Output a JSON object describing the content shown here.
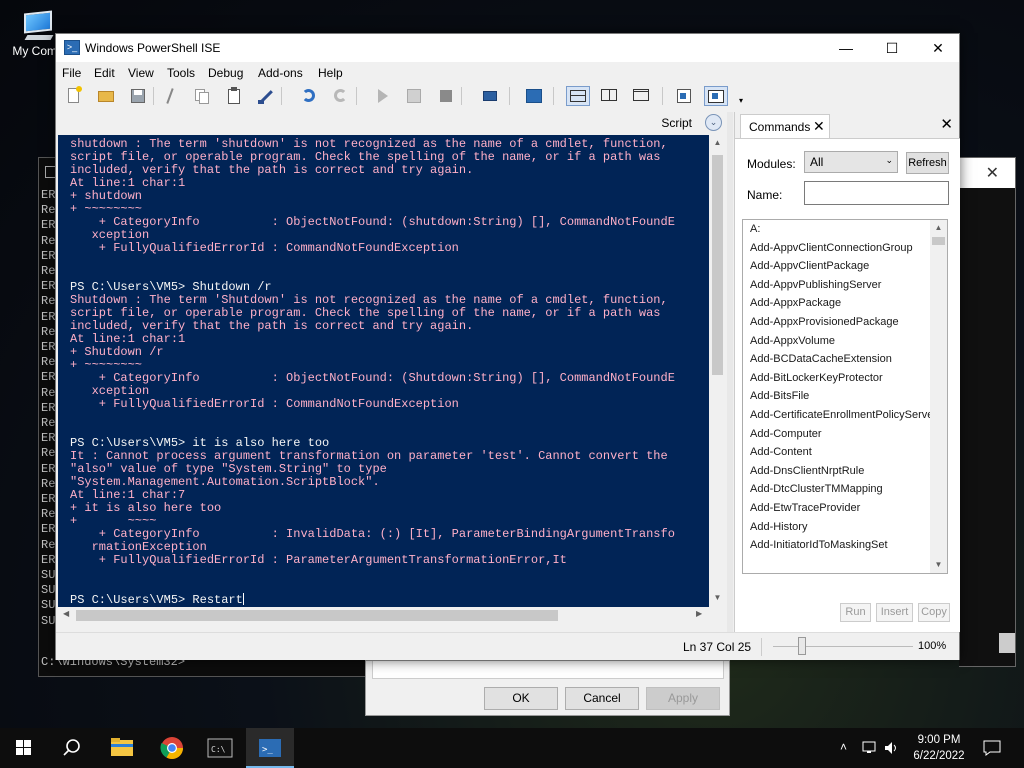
{
  "desktop": {
    "icon_label": "My Comp"
  },
  "bg_cmd": {
    "line_prefixes": [
      "ER",
      "Re",
      "ER",
      "Re",
      "ER",
      "Re",
      "ER",
      "Re",
      "ER",
      "Re",
      "ER",
      "Re",
      "ER",
      "Re",
      "ER",
      "Re",
      "ER",
      "Re",
      "ER",
      "Re",
      "ER",
      "Re",
      "ER",
      "Re",
      "ER",
      "SU",
      "SU",
      "SU",
      "SU"
    ],
    "prompt": "C:\\Windows\\System32>"
  },
  "dialog": {
    "ok": "OK",
    "cancel": "Cancel",
    "apply": "Apply"
  },
  "ise": {
    "title": "Windows PowerShell ISE",
    "menu": [
      "File",
      "Edit",
      "View",
      "Tools",
      "Debug",
      "Add-ons",
      "Help"
    ],
    "script_label": "Script",
    "console_lines": [
      {
        "t": "shutdown : The term 'shutdown' is not recognized as the name of a cmdlet, function,",
        "c": "e"
      },
      {
        "t": "script file, or operable program. Check the spelling of the name, or if a path was",
        "c": "e"
      },
      {
        "t": "included, verify that the path is correct and try again.",
        "c": "e"
      },
      {
        "t": "At line:1 char:1",
        "c": "e"
      },
      {
        "t": "+ shutdown",
        "c": "e"
      },
      {
        "t": "+ ~~~~~~~~",
        "c": "e"
      },
      {
        "t": "    + CategoryInfo          : ObjectNotFound: (shutdown:String) [], CommandNotFoundE",
        "c": "e"
      },
      {
        "t": "   xception",
        "c": "e"
      },
      {
        "t": "    + FullyQualifiedErrorId : CommandNotFoundException",
        "c": "e"
      },
      {
        "t": "",
        "c": "w"
      },
      {
        "t": "",
        "c": "w"
      },
      {
        "t": "PS C:\\Users\\VM5> Shutdown /r",
        "c": "w"
      },
      {
        "t": "Shutdown : The term 'Shutdown' is not recognized as the name of a cmdlet, function,",
        "c": "e"
      },
      {
        "t": "script file, or operable program. Check the spelling of the name, or if a path was",
        "c": "e"
      },
      {
        "t": "included, verify that the path is correct and try again.",
        "c": "e"
      },
      {
        "t": "At line:1 char:1",
        "c": "e"
      },
      {
        "t": "+ Shutdown /r",
        "c": "e"
      },
      {
        "t": "+ ~~~~~~~~",
        "c": "e"
      },
      {
        "t": "    + CategoryInfo          : ObjectNotFound: (Shutdown:String) [], CommandNotFoundE",
        "c": "e"
      },
      {
        "t": "   xception",
        "c": "e"
      },
      {
        "t": "    + FullyQualifiedErrorId : CommandNotFoundException",
        "c": "e"
      },
      {
        "t": "",
        "c": "w"
      },
      {
        "t": "",
        "c": "w"
      },
      {
        "t": "PS C:\\Users\\VM5> it is also here too",
        "c": "w"
      },
      {
        "t": "It : Cannot process argument transformation on parameter 'test'. Cannot convert the",
        "c": "e"
      },
      {
        "t": "\"also\" value of type \"System.String\" to type",
        "c": "e"
      },
      {
        "t": "\"System.Management.Automation.ScriptBlock\".",
        "c": "e"
      },
      {
        "t": "At line:1 char:7",
        "c": "e"
      },
      {
        "t": "+ it is also here too",
        "c": "e"
      },
      {
        "t": "+       ~~~~",
        "c": "e"
      },
      {
        "t": "    + CategoryInfo          : InvalidData: (:) [It], ParameterBindingArgumentTransfo",
        "c": "e"
      },
      {
        "t": "   rmationException",
        "c": "e"
      },
      {
        "t": "    + FullyQualifiedErrorId : ParameterArgumentTransformationError,It",
        "c": "e"
      },
      {
        "t": "",
        "c": "w"
      },
      {
        "t": "",
        "c": "w"
      }
    ],
    "current_input": "PS C:\\Users\\VM5> Restart",
    "colors": {
      "console_bg": "#012456",
      "error_text": "#ffb0c8",
      "normal_text": "#f5f5f5"
    }
  },
  "commands": {
    "tab_label": "Commands",
    "modules_label": "Modules:",
    "modules_value": "All",
    "refresh_label": "Refresh",
    "name_label": "Name:",
    "name_value": "",
    "items": [
      "A:",
      "Add-AppvClientConnectionGroup",
      "Add-AppvClientPackage",
      "Add-AppvPublishingServer",
      "Add-AppxPackage",
      "Add-AppxProvisionedPackage",
      "Add-AppxVolume",
      "Add-BCDataCacheExtension",
      "Add-BitLockerKeyProtector",
      "Add-BitsFile",
      "Add-CertificateEnrollmentPolicyServe",
      "Add-Computer",
      "Add-Content",
      "Add-DnsClientNrptRule",
      "Add-DtcClusterTMMapping",
      "Add-EtwTraceProvider",
      "Add-History",
      "Add-InitiatorIdToMaskingSet"
    ],
    "run_label": "Run",
    "insert_label": "Insert",
    "copy_label": "Copy"
  },
  "status": {
    "position": "Ln 37  Col 25",
    "zoom": "100%"
  },
  "taskbar": {
    "time": "9:00 PM",
    "date": "6/22/2022"
  }
}
